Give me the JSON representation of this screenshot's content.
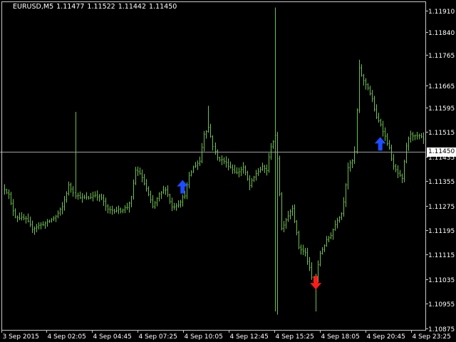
{
  "header": {
    "symbol": "EURUSD,M5",
    "open": "1.11477",
    "high": "1.11522",
    "low": "1.11442",
    "close": "1.11450"
  },
  "colors": {
    "background": "#000000",
    "bars": "#6fbf4e",
    "axis": "#c8c8c8",
    "bid_line": "#a0a0a0",
    "buy_arrow": "#1e4cff",
    "sell_arrow": "#ff1a1a"
  },
  "chart_data": {
    "type": "bar",
    "title": "EURUSD,M5",
    "current_price": 1.1145,
    "current_price_label": "1.11450",
    "ylim": [
      1.1087,
      1.1194
    ],
    "y_ticks": [
      "1.11910",
      "1.11840",
      "1.11765",
      "1.11665",
      "1.11595",
      "1.11515",
      "1.11435",
      "1.11355",
      "1.11275",
      "1.11195",
      "1.11115",
      "1.11035",
      "1.10955",
      "1.10875"
    ],
    "x_ticks": [
      "3 Sep 2015",
      "4 Sep 02:05",
      "4 Sep 04:45",
      "4 Sep 07:25",
      "4 Sep 10:05",
      "4 Sep 12:45",
      "4 Sep 15:25",
      "4 Sep 18:05",
      "4 Sep 20:45",
      "4 Sep 23:25"
    ],
    "grid": false,
    "anchors": [
      [
        0,
        1.1133
      ],
      [
        2,
        1.1131
      ],
      [
        3,
        1.1128
      ],
      [
        5,
        1.1124
      ],
      [
        10,
        1.1123
      ],
      [
        13,
        1.112
      ],
      [
        16,
        1.1121
      ],
      [
        20,
        1.1122
      ],
      [
        24,
        1.1124
      ],
      [
        27,
        1.1127
      ],
      [
        30,
        1.1134
      ],
      [
        33,
        1.1131
      ],
      [
        36,
        1.113
      ],
      [
        39,
        1.113
      ],
      [
        42,
        1.1131
      ],
      [
        45,
        1.113
      ],
      [
        48,
        1.1126
      ],
      [
        51,
        1.1126
      ],
      [
        54,
        1.1126
      ],
      [
        57,
        1.1127
      ],
      [
        59,
        1.113
      ],
      [
        61,
        1.1139
      ],
      [
        63,
        1.1138
      ],
      [
        66,
        1.1133
      ],
      [
        69,
        1.1127
      ],
      [
        72,
        1.1131
      ],
      [
        75,
        1.1133
      ],
      [
        78,
        1.1127
      ],
      [
        81,
        1.1128
      ],
      [
        84,
        1.1131
      ],
      [
        86,
        1.1137
      ],
      [
        88,
        1.114
      ],
      [
        91,
        1.1142
      ],
      [
        93,
        1.1151
      ],
      [
        95,
        1.1153
      ],
      [
        97,
        1.1147
      ],
      [
        99,
        1.1143
      ],
      [
        102,
        1.1142
      ],
      [
        105,
        1.114
      ],
      [
        108,
        1.1138
      ],
      [
        111,
        1.114
      ],
      [
        114,
        1.1134
      ],
      [
        117,
        1.1138
      ],
      [
        120,
        1.114
      ],
      [
        122,
        1.1139
      ],
      [
        124,
        1.1147
      ],
      [
        126,
        1.115
      ],
      [
        127,
        1.1143
      ],
      [
        129,
        1.112
      ],
      [
        131,
        1.1123
      ],
      [
        134,
        1.1127
      ],
      [
        137,
        1.1114
      ],
      [
        140,
        1.1112
      ],
      [
        142,
        1.1107
      ],
      [
        143,
        1.1104
      ],
      [
        145,
        1.1104
      ],
      [
        147,
        1.1112
      ],
      [
        150,
        1.1116
      ],
      [
        152,
        1.1118
      ],
      [
        155,
        1.1123
      ],
      [
        157,
        1.1125
      ],
      [
        158,
        1.1129
      ],
      [
        160,
        1.114
      ],
      [
        162,
        1.1142
      ],
      [
        163,
        1.1145
      ],
      [
        165,
        1.1172
      ],
      [
        167,
        1.1168
      ],
      [
        169,
        1.1166
      ],
      [
        171,
        1.1162
      ],
      [
        173,
        1.1156
      ],
      [
        175,
        1.1154
      ],
      [
        177,
        1.115
      ],
      [
        179,
        1.1146
      ],
      [
        181,
        1.114
      ],
      [
        183,
        1.1138
      ],
      [
        185,
        1.1136
      ],
      [
        187,
        1.1147
      ],
      [
        189,
        1.1151
      ],
      [
        191,
        1.115
      ],
      [
        193,
        1.115
      ],
      [
        195,
        1.1149
      ]
    ],
    "spikes": [
      [
        33,
        1.1158,
        null
      ],
      [
        95,
        1.116,
        null
      ],
      [
        126,
        1.1192,
        1.1093
      ],
      [
        127,
        null,
        1.1092
      ],
      [
        145,
        null,
        1.1093
      ],
      [
        165,
        1.1175,
        null
      ]
    ],
    "signals": [
      {
        "type": "buy",
        "bar": 83,
        "price": 1.11335
      },
      {
        "type": "sell",
        "bar": 145,
        "price": 1.11025
      },
      {
        "type": "buy",
        "bar": 175,
        "price": 1.11475
      }
    ]
  }
}
